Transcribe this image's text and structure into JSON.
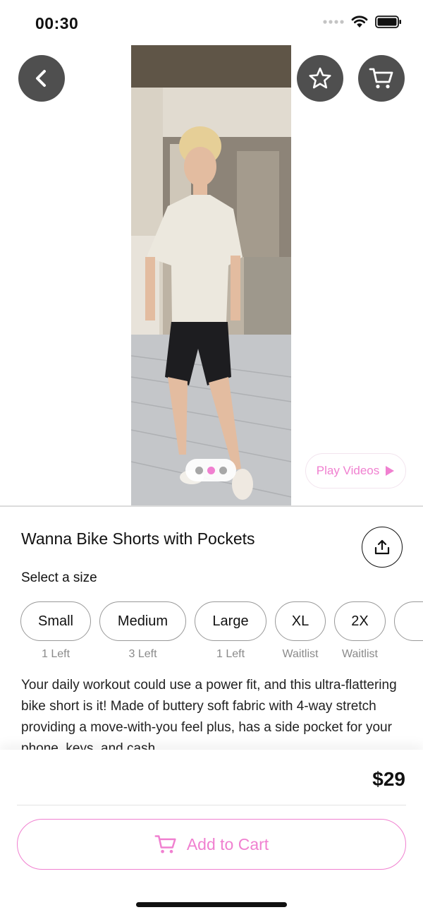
{
  "status_bar": {
    "time": "00:30"
  },
  "colors": {
    "accent": "#f080d0",
    "button_dark": "#4f4f4f"
  },
  "header": {
    "back_icon": "chevron-left-icon",
    "favorite_icon": "star-icon",
    "cart_icon": "cart-icon"
  },
  "gallery": {
    "slides": 3,
    "active_slide": 2,
    "play_videos_label": "Play Videos"
  },
  "product": {
    "title": "Wanna Bike Shorts with Pockets",
    "select_size_label": "Select a size",
    "sizes": [
      {
        "label": "Small",
        "availability": "1 Left"
      },
      {
        "label": "Medium",
        "availability": "3 Left"
      },
      {
        "label": "Large",
        "availability": "1 Left"
      },
      {
        "label": "XL",
        "availability": "Waitlist"
      },
      {
        "label": "2X",
        "availability": "Waitlist"
      }
    ],
    "description": "Your daily workout could use a power fit, and this ultra-flattering bike short is it! Made of buttery soft fabric with 4-way stretch providing a move-with-you feel plus, has a side pocket for your phone, keys, and cash."
  },
  "footer": {
    "price": "$29",
    "add_to_cart_label": "Add to Cart"
  }
}
